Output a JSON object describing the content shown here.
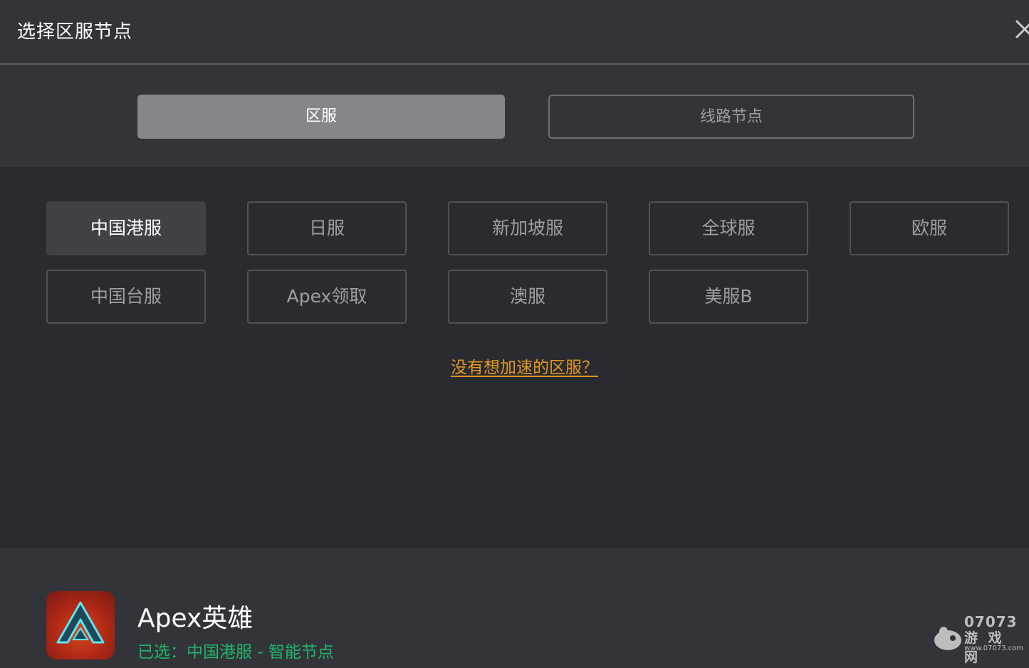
{
  "header": {
    "title": "选择区服节点",
    "close_icon": "close-icon"
  },
  "tabs": [
    {
      "label": "区服",
      "active": true
    },
    {
      "label": "线路节点",
      "active": false
    }
  ],
  "regions": [
    {
      "label": "中国港服",
      "selected": true
    },
    {
      "label": "日服",
      "selected": false
    },
    {
      "label": "新加坡服",
      "selected": false
    },
    {
      "label": "全球服",
      "selected": false
    },
    {
      "label": "欧服",
      "selected": false
    },
    {
      "label": "中国台服",
      "selected": false
    },
    {
      "label": "Apex领取",
      "selected": false
    },
    {
      "label": "澳服",
      "selected": false
    },
    {
      "label": "美服B",
      "selected": false
    }
  ],
  "help_link": "没有想加速的区服？",
  "footer": {
    "game_name": "Apex英雄",
    "status": "已选：中国港服 - 智能节点",
    "icon": "apex-legends-logo-icon"
  },
  "watermark": {
    "number": "07073",
    "name": "游 戏 网",
    "url": "www.07073.com"
  },
  "colors": {
    "accent_link": "#e0961f",
    "status_green": "#1fb46a",
    "active_tab": "#85868a",
    "selected_region": "#404146"
  }
}
